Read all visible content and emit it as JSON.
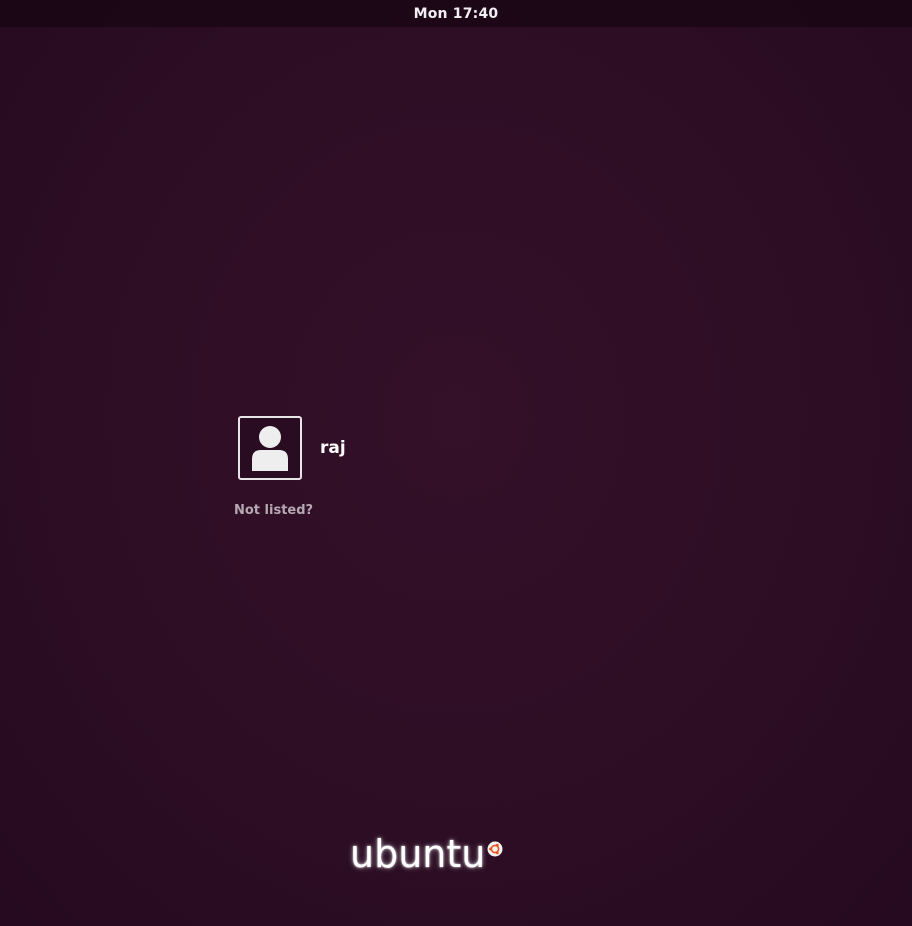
{
  "topbar": {
    "clock": "Mon 17:40"
  },
  "users": [
    {
      "name": "raj",
      "avatar_icon": "user-avatar-icon"
    }
  ],
  "not_listed_label": "Not listed?",
  "branding": {
    "logo_text": "ubuntu",
    "logo_mark_icon": "circle-of-friends-icon",
    "accent_color": "#e95420"
  },
  "colors": {
    "background": "#2c0d24",
    "text": "#ffffff",
    "muted_text": "#b6a8b2"
  }
}
